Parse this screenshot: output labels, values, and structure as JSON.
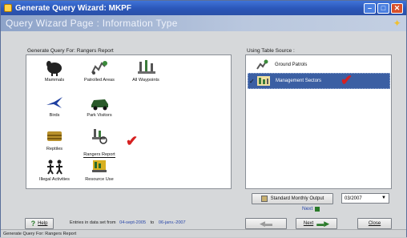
{
  "window": {
    "title": "Generate Query Wizard: MKPF"
  },
  "header": {
    "title": "Query Wizard Page : Information Type"
  },
  "left_panel": {
    "caption": "Generate Query For: Rangers Report",
    "items": [
      {
        "label": "Mammals",
        "icon": "mammals-icon"
      },
      {
        "label": "Patrolled Areas",
        "icon": "patrolled-areas-icon"
      },
      {
        "label": "All Waypoints",
        "icon": "all-waypoints-icon"
      },
      {
        "label": "Birds",
        "icon": "birds-icon"
      },
      {
        "label": "Park Visitors",
        "icon": "park-visitors-icon"
      },
      {
        "label": "Reptiles",
        "icon": "reptiles-icon"
      },
      {
        "label": "Rangers Report",
        "icon": "rangers-report-icon",
        "selected": true
      },
      {
        "label": "Illegal Activities",
        "icon": "illegal-activities-icon"
      },
      {
        "label": "Resource Use",
        "icon": "resource-use-icon"
      }
    ]
  },
  "right_panel": {
    "caption": "Using Table Source :",
    "items": [
      {
        "label": "Ground Patrols",
        "icon": "ground-patrols-icon"
      },
      {
        "label": "Management Sectors",
        "icon": "management-sectors-icon",
        "selected": true
      }
    ]
  },
  "controls": {
    "standard_output_label": "Standard Monthly Output",
    "date_value": "03/2007",
    "next_link": "Next"
  },
  "footer": {
    "help_label": "Help",
    "entries_prefix": "Entries in data set from",
    "date_from": "04-sept-2005",
    "to_word": "to",
    "date_to": "06-janv.-2007",
    "back_label": "",
    "next_label": "Next",
    "close_label": "Close"
  },
  "status": {
    "text": "Generate Query For: Rangers Report"
  },
  "colors": {
    "accent": "#2a56b8",
    "selection": "#3b5fa3",
    "tick": "#d62020"
  }
}
